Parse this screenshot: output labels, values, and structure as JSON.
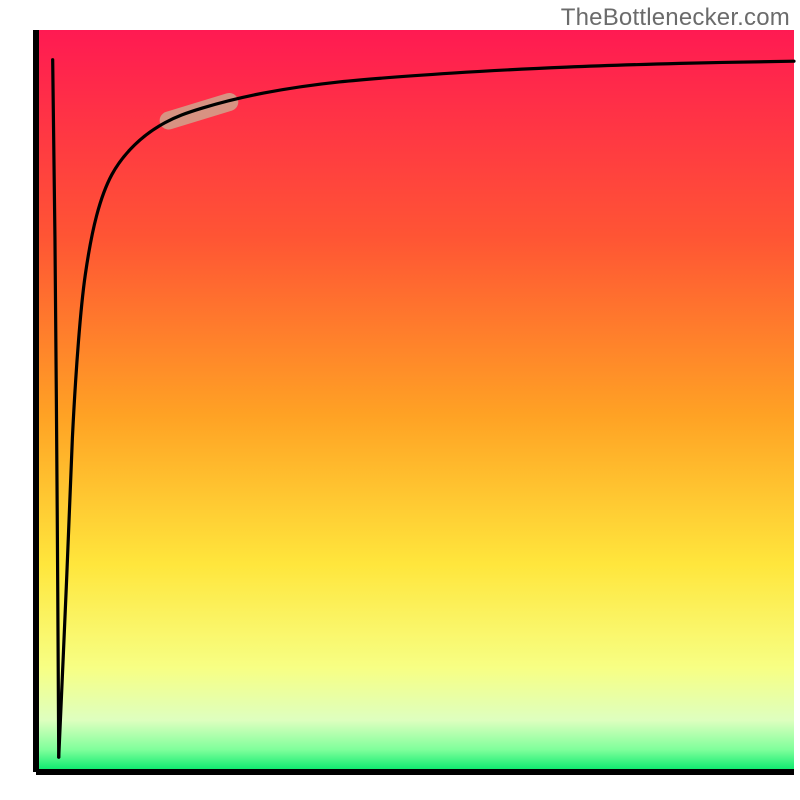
{
  "watermark": {
    "text": "TheBottlenecker.com"
  },
  "chart_data": {
    "type": "line",
    "title": "",
    "xlabel": "",
    "ylabel": "",
    "xlim": [
      0,
      100
    ],
    "ylim": [
      0,
      100
    ],
    "grid": false,
    "legend": false,
    "background_gradient": {
      "stops": [
        {
          "offset": 0.0,
          "color": "#ff1a52"
        },
        {
          "offset": 0.28,
          "color": "#ff5534"
        },
        {
          "offset": 0.52,
          "color": "#ffa224"
        },
        {
          "offset": 0.72,
          "color": "#ffe63c"
        },
        {
          "offset": 0.86,
          "color": "#f7ff84"
        },
        {
          "offset": 0.93,
          "color": "#deffbf"
        },
        {
          "offset": 0.97,
          "color": "#7fff9b"
        },
        {
          "offset": 1.0,
          "color": "#00e86a"
        }
      ]
    },
    "series": [
      {
        "name": "bottleneck-curve",
        "note": "percent bottleneck vs x; values estimated from gridlines",
        "x": [
          3.0,
          4.0,
          4.8,
          5.6,
          6.5,
          8.0,
          10.0,
          13.0,
          17.0,
          22.0,
          30.0,
          40.0,
          55.0,
          70.0,
          85.0,
          100.0
        ],
        "values": [
          2.0,
          25.0,
          45.0,
          58.0,
          67.0,
          75.0,
          80.5,
          84.5,
          87.5,
          89.5,
          91.5,
          93.0,
          94.2,
          95.0,
          95.5,
          95.8
        ]
      },
      {
        "name": "initial-drop",
        "note": "sharp fall at far left (from near top to near bottom)",
        "x": [
          2.2,
          2.5,
          2.8,
          3.0
        ],
        "values": [
          96.0,
          72.0,
          35.0,
          2.0
        ]
      }
    ],
    "marker_segment": {
      "note": "highlighted pink pill along the curve",
      "x_start": 17.5,
      "y_start": 87.8,
      "x_end": 25.5,
      "y_end": 90.3,
      "color": "#d89282"
    },
    "axes": {
      "left_color": "#000000",
      "bottom_color": "#000000"
    }
  }
}
